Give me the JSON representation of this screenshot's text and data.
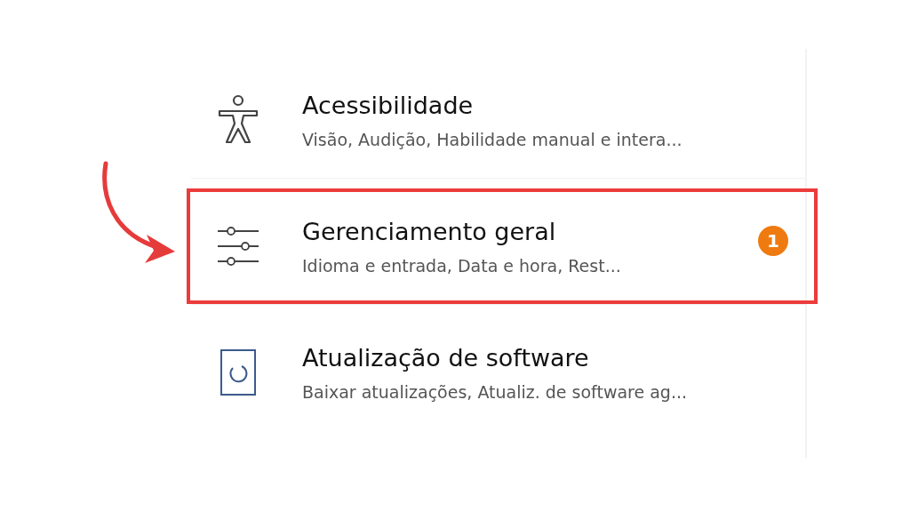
{
  "settings_items": [
    {
      "kind": "accessibility",
      "title": "Acessibilidade",
      "subtitle": "Visão, Audição, Habilidade manual e intera...",
      "highlighted": false
    },
    {
      "kind": "sliders",
      "title": "Gerenciamento geral",
      "subtitle": "Idioma e entrada, Data e hora, Rest...",
      "highlighted": true,
      "badge": "1"
    },
    {
      "kind": "update",
      "title": "Atualização de software",
      "subtitle": "Baixar atualizações, Atualiz. de software ag...",
      "highlighted": false
    }
  ]
}
